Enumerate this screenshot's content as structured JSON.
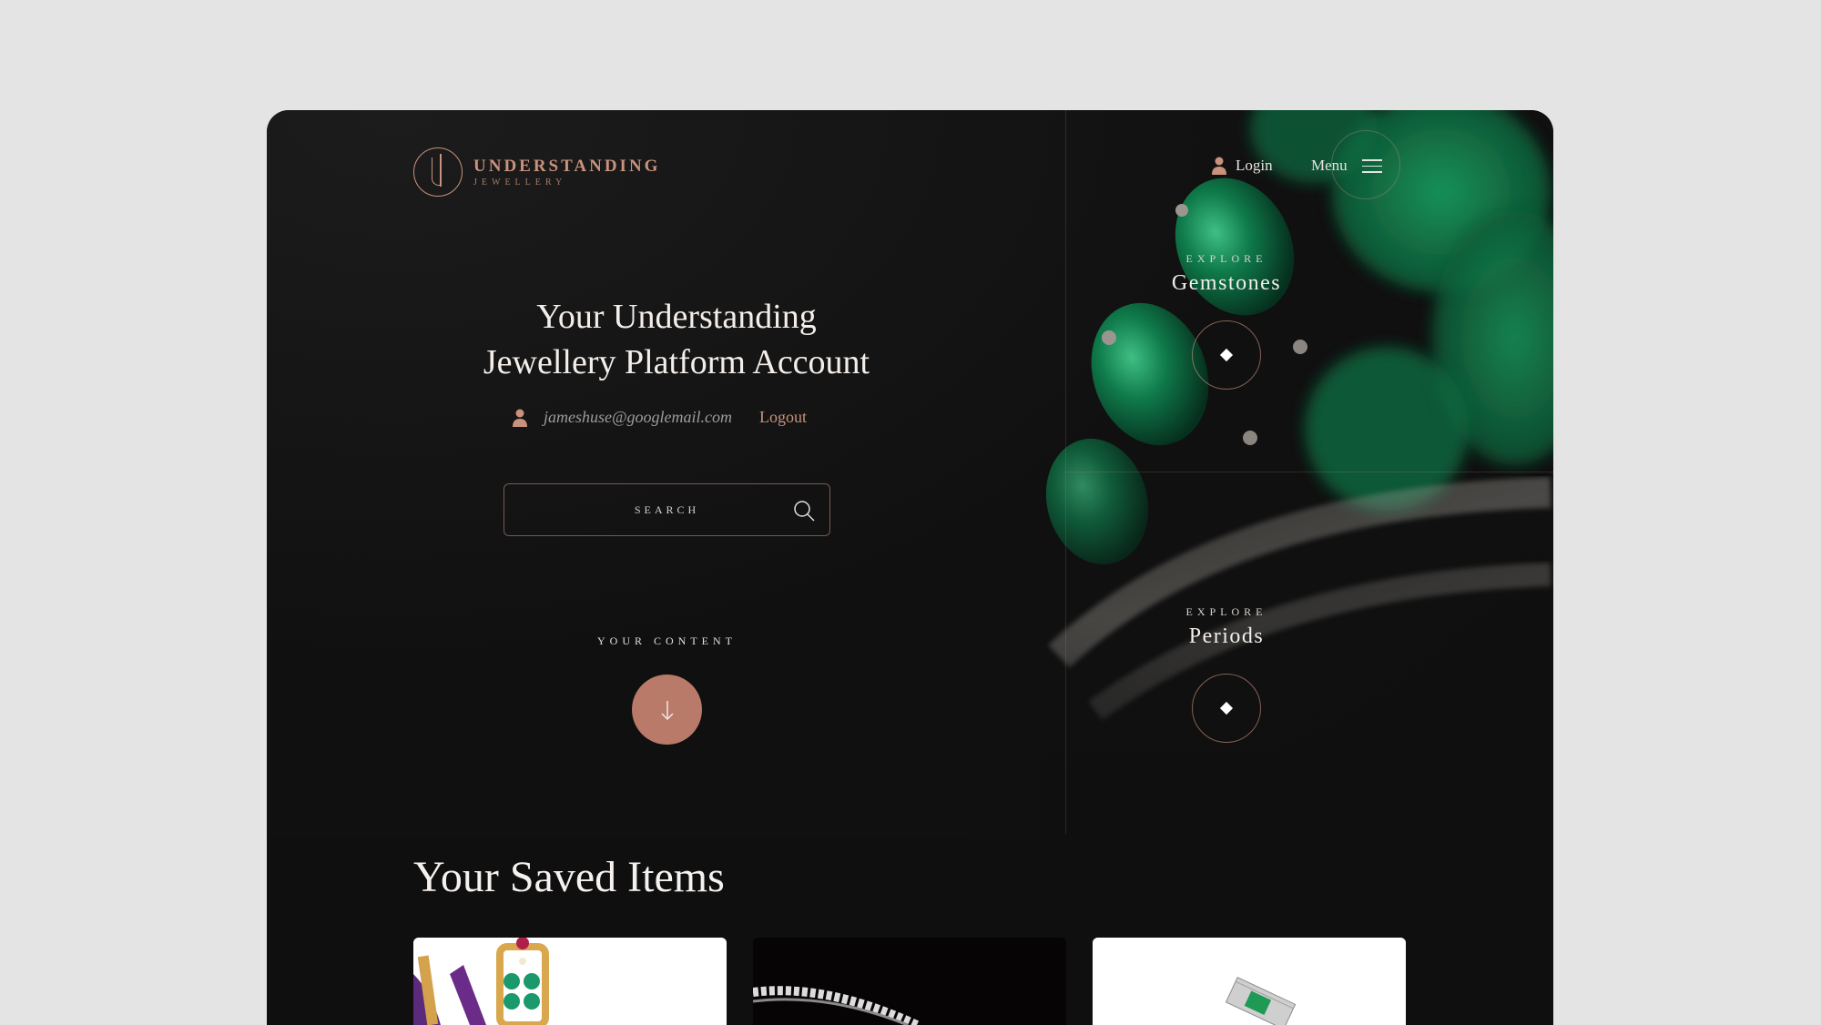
{
  "brand": {
    "title": "UNDERSTANDING",
    "subtitle": "JEWELLERY"
  },
  "header": {
    "login_label": "Login",
    "menu_label": "Menu"
  },
  "hero": {
    "title_line1": "Your Understanding",
    "title_line2": "Jewellery Platform Account",
    "email": "jameshuse@googlemail.com",
    "logout_label": "Logout",
    "search_placeholder": "SEARCH",
    "content_label": "YOUR CONTENT"
  },
  "explore": [
    {
      "label": "EXPLORE",
      "title": "Gemstones"
    },
    {
      "label": "EXPLORE",
      "title": "Periods"
    }
  ],
  "saved": {
    "title": "Your Saved Items"
  },
  "colors": {
    "accent": "#c9927d",
    "button": "#b97a69",
    "background": "#0f0f10",
    "page": "#e4e4e5"
  },
  "icons": [
    "user-icon",
    "hamburger-icon",
    "search-icon",
    "arrow-down-icon",
    "diamond-icon"
  ]
}
